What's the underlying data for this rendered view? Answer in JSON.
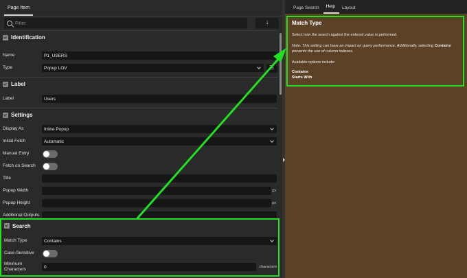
{
  "left_panel": {
    "tab": "Page Item",
    "filter_placeholder": "Filter",
    "go_glyph": "↓",
    "sections": {
      "identification": {
        "title": "Identification",
        "name_label": "Name",
        "name_value": "P1_USERS",
        "type_label": "Type",
        "type_value": "Popup LOV"
      },
      "label": {
        "title": "Label",
        "label_label": "Label",
        "label_value": "Users"
      },
      "settings": {
        "title": "Settings",
        "display_as_label": "Display As",
        "display_as_value": "Inline Popup",
        "initial_fetch_label": "Initial Fetch",
        "initial_fetch_value": "Automatic",
        "manual_entry_label": "Manual Entry",
        "fetch_on_search_label": "Fetch on Search",
        "title_label": "Title",
        "popup_width_label": "Popup Width",
        "popup_width_unit": "px",
        "popup_height_label": "Popup Height",
        "popup_height_unit": "px",
        "additional_outputs_label": "Additional Outputs"
      },
      "search": {
        "title": "Search",
        "match_type_label": "Match Type",
        "match_type_value": "Contains",
        "case_sensitive_label": "Case-Sensitive",
        "minimum_characters_label": "Minimum Characters",
        "minimum_characters_value": "0",
        "minimum_characters_unit": "characters"
      }
    }
  },
  "right_panel": {
    "tabs": [
      "Page Search",
      "Help",
      "Layout"
    ],
    "active_tab": "Help",
    "help": {
      "title": "Match Type",
      "description": "Select how the search against the entered value is performed.",
      "note_before": "Note: This setting can have an impact on query performance. Additionally, selecting ",
      "note_bold": "Contains",
      "note_after": " prevents the use of column indexes.",
      "options_intro": "Available options include:",
      "options": [
        "Contains",
        "Starts With"
      ]
    }
  },
  "colors": {
    "highlight": "#22e022",
    "help_background": "#5b4125"
  }
}
